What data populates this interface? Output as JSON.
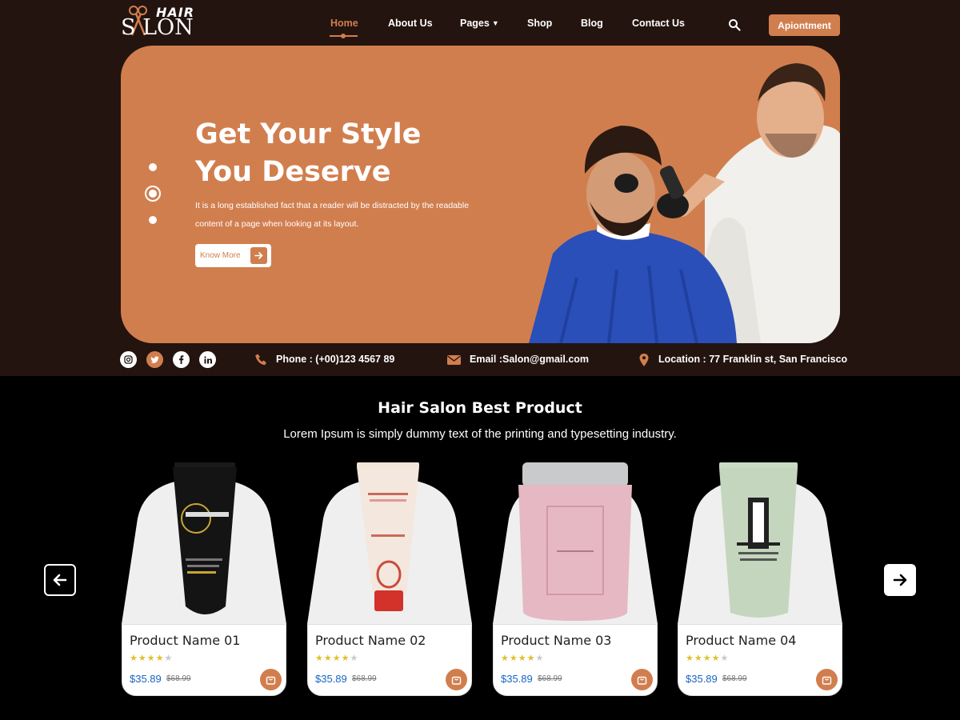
{
  "brand": {
    "hair": "HAIR",
    "salon": "S LON"
  },
  "nav": {
    "items": [
      "Home",
      "About Us",
      "Pages",
      "Shop",
      "Blog",
      "Contact Us"
    ],
    "appointment": "Apiontment"
  },
  "hero": {
    "title_line1": "Get Your Style",
    "title_line2": "You Deserve",
    "description": "It is a long established fact that a reader will be distracted by the readable content of a page when looking at its layout.",
    "button": "Know More"
  },
  "info": {
    "phone": "Phone : (+00)123 4567 89",
    "email": "Email :Salon@gmail.com",
    "location": "Location : 77 Franklin st, San Francisco"
  },
  "products_section": {
    "title": "Hair Salon Best Product",
    "subtitle": "Lorem Ipsum is simply dummy text of the printing and typesetting industry."
  },
  "products": [
    {
      "name": "Product Name 01",
      "price": "$35.89",
      "old_price": "$68.99",
      "rating": 4
    },
    {
      "name": "Product Name 02",
      "price": "$35.89",
      "old_price": "$68.99",
      "rating": 4
    },
    {
      "name": "Product Name 03",
      "price": "$35.89",
      "old_price": "$68.99",
      "rating": 4
    },
    {
      "name": "Product Name 04",
      "price": "$35.89",
      "old_price": "$68.99",
      "rating": 4
    }
  ],
  "colors": {
    "accent": "#d17e4e",
    "dark": "#23140f",
    "price": "#1a64c4",
    "star": "#e0c02a"
  }
}
